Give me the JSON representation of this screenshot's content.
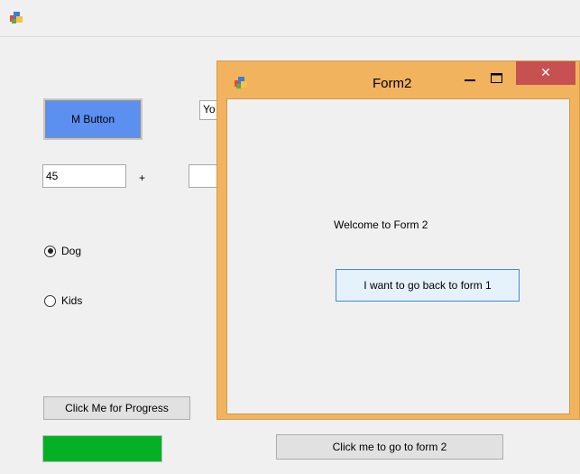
{
  "form1": {
    "title_icon": "winforms-app-icon",
    "m_button_label": "M Button",
    "top_textbox_value": "Yo",
    "number_input_value": "45",
    "operator_label": "+",
    "second_number_value": "",
    "radio_options": [
      {
        "label": "Dog",
        "checked": true
      },
      {
        "label": "Kids",
        "checked": false
      }
    ],
    "progress_button_label": "Click Me for Progress",
    "progress_value_percent": 100,
    "progress_color": "#06b025",
    "go_to_form2_label": "Click me to go to form 2"
  },
  "form2": {
    "title": "Form2",
    "title_icon": "winforms-app-icon",
    "minimize_icon": "minimize-icon",
    "maximize_icon": "maximize-icon",
    "close_icon": "close-icon",
    "close_glyph": "✕",
    "welcome_text": "Welcome to Form 2",
    "back_button_label": "I want to go back to form 1",
    "frame_color": "#f1b35e",
    "close_color": "#c75050"
  }
}
